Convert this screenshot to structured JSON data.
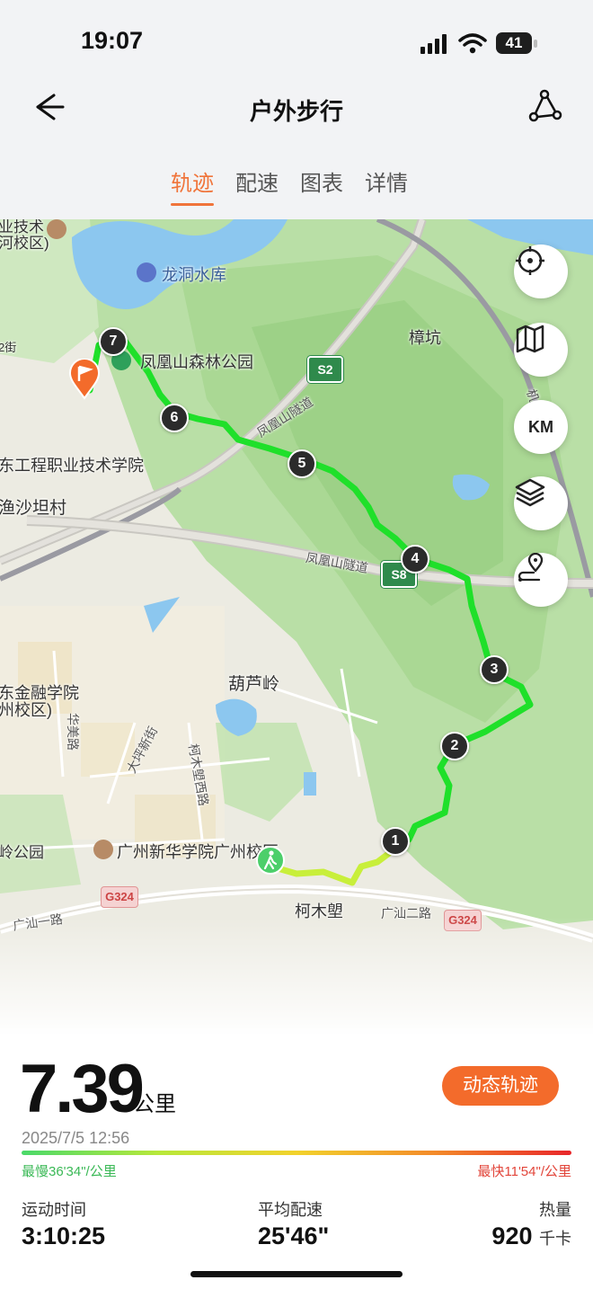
{
  "status_bar": {
    "time": "19:07",
    "battery": "41"
  },
  "header": {
    "title": "户外步行"
  },
  "tabs": [
    {
      "label": "轨迹",
      "active": true
    },
    {
      "label": "配速",
      "active": false
    },
    {
      "label": "图表",
      "active": false
    },
    {
      "label": "详情",
      "active": false
    }
  ],
  "map": {
    "labels": {
      "reservoir": "龙洞水库",
      "park": "凤凰山森林公园",
      "zhangkeng": "樟坑",
      "college1": "东工程职业技术学院",
      "yushatan": "渔沙坦村",
      "finance1": "东金融学院",
      "finance2": "州校区)",
      "hululing": "葫芦岭",
      "xinhua": "广州新华学院广州校区",
      "kemulang": "柯木塱",
      "lingpark": "岭公园",
      "topleft1": "业技术",
      "topleft2": "河校区)",
      "street_left": "2街",
      "tunnel1": "凤凰山隧道",
      "tunnel2": "凤凰山隧道",
      "road_guangshan1": "广汕一路",
      "road_guangshan2": "广汕二路",
      "road_huamei": "华美路",
      "road_daping": "大坪新街",
      "road_kemulang_west": "柯木塱西路",
      "road_right": "机"
    },
    "highways": {
      "s2": "S2",
      "s8": "S8",
      "g324a": "G324",
      "g324b": "G324"
    },
    "km_markers": [
      "1",
      "2",
      "3",
      "4",
      "5",
      "6",
      "7"
    ],
    "route_colors": {
      "fast": "#1fe02a",
      "slow": "#c8ef3a"
    }
  },
  "map_controls": {
    "km_label": "KM"
  },
  "summary": {
    "distance": "7.39",
    "distance_unit": "公里",
    "dynamic_track": "动态轨迹",
    "datetime": "2025/7/5 12:56",
    "slowest": "最慢36'34\"/公里",
    "fastest": "最快11'54\"/公里"
  },
  "stats": [
    {
      "label": "运动时间",
      "value": "3:10:25",
      "unit": ""
    },
    {
      "label": "平均配速",
      "value": "25'46\"",
      "unit": ""
    },
    {
      "label": "热量",
      "value": "920",
      "unit": "千卡"
    }
  ],
  "colors": {
    "accent": "#f36b2b",
    "tab_active": "#f0743a"
  }
}
